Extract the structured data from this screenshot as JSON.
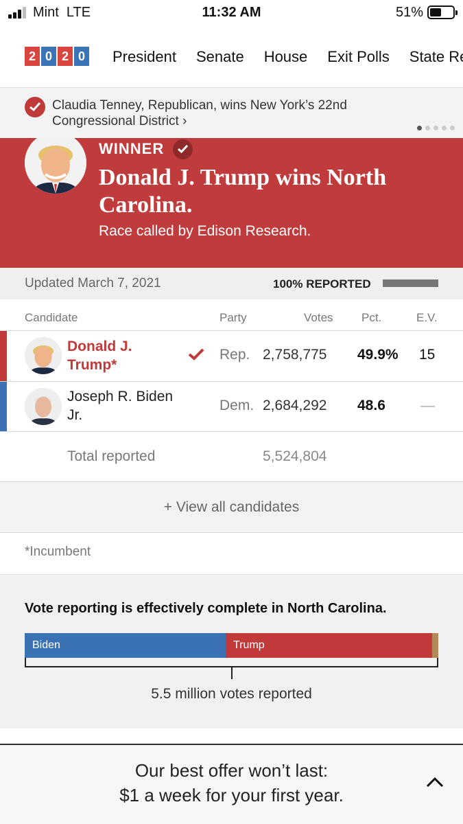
{
  "status_bar": {
    "carrier": "Mint",
    "network": "LTE",
    "time": "11:32 AM",
    "battery": "51%"
  },
  "nav": {
    "logo_digits": [
      "2",
      "0",
      "2",
      "0"
    ],
    "items": [
      "President",
      "Senate",
      "House",
      "Exit Polls",
      "State Re"
    ]
  },
  "ticker": {
    "text": "Claudia Tenney, Republican, wins New York’s 22nd Congressional District ›",
    "page_count": 5,
    "active_page": 1
  },
  "banner": {
    "winner_label": "WINNER",
    "headline": "Donald J. Trump wins North Carolina.",
    "subtext": "Race called by Edison Research."
  },
  "updated": {
    "text": "Updated March 7, 2021",
    "reported": "100% REPORTED",
    "reported_fraction": 1.0
  },
  "table": {
    "headers": {
      "candidate": "Candidate",
      "party": "Party",
      "votes": "Votes",
      "pct": "Pct.",
      "ev": "E.V."
    },
    "rows": [
      {
        "name_line1": "Donald J.",
        "name_line2": "Trump*",
        "party": "Rep.",
        "votes": "2,758,775",
        "pct": "49.9%",
        "ev": "15"
      },
      {
        "name_line1": "Joseph R. Biden",
        "name_line2": "Jr.",
        "party": "Dem.",
        "votes": "2,684,292",
        "pct": "48.6",
        "ev": "—"
      }
    ],
    "total_label": "Total reported",
    "total_votes": "5,524,804"
  },
  "view_all": "+ View all candidates",
  "incumbent_note": "*Incumbent",
  "reporting": {
    "title": "Vote reporting is effectively complete in North Carolina.",
    "segments": [
      {
        "label": "Biden",
        "share": 48.6,
        "color": "#3a72b4"
      },
      {
        "label": "Trump",
        "share": 49.9,
        "color": "#c13a3a"
      },
      {
        "label": "",
        "share": 1.5,
        "color": "#b38a5a"
      }
    ],
    "votes_text": "5.5 million votes reported"
  },
  "offer": {
    "line1": "Our best offer won’t last:",
    "line2": "$1 a week for your first year."
  },
  "colors": {
    "republican": "#c13a3a",
    "democrat": "#3a72b4",
    "banner": "#bf3b3c"
  }
}
